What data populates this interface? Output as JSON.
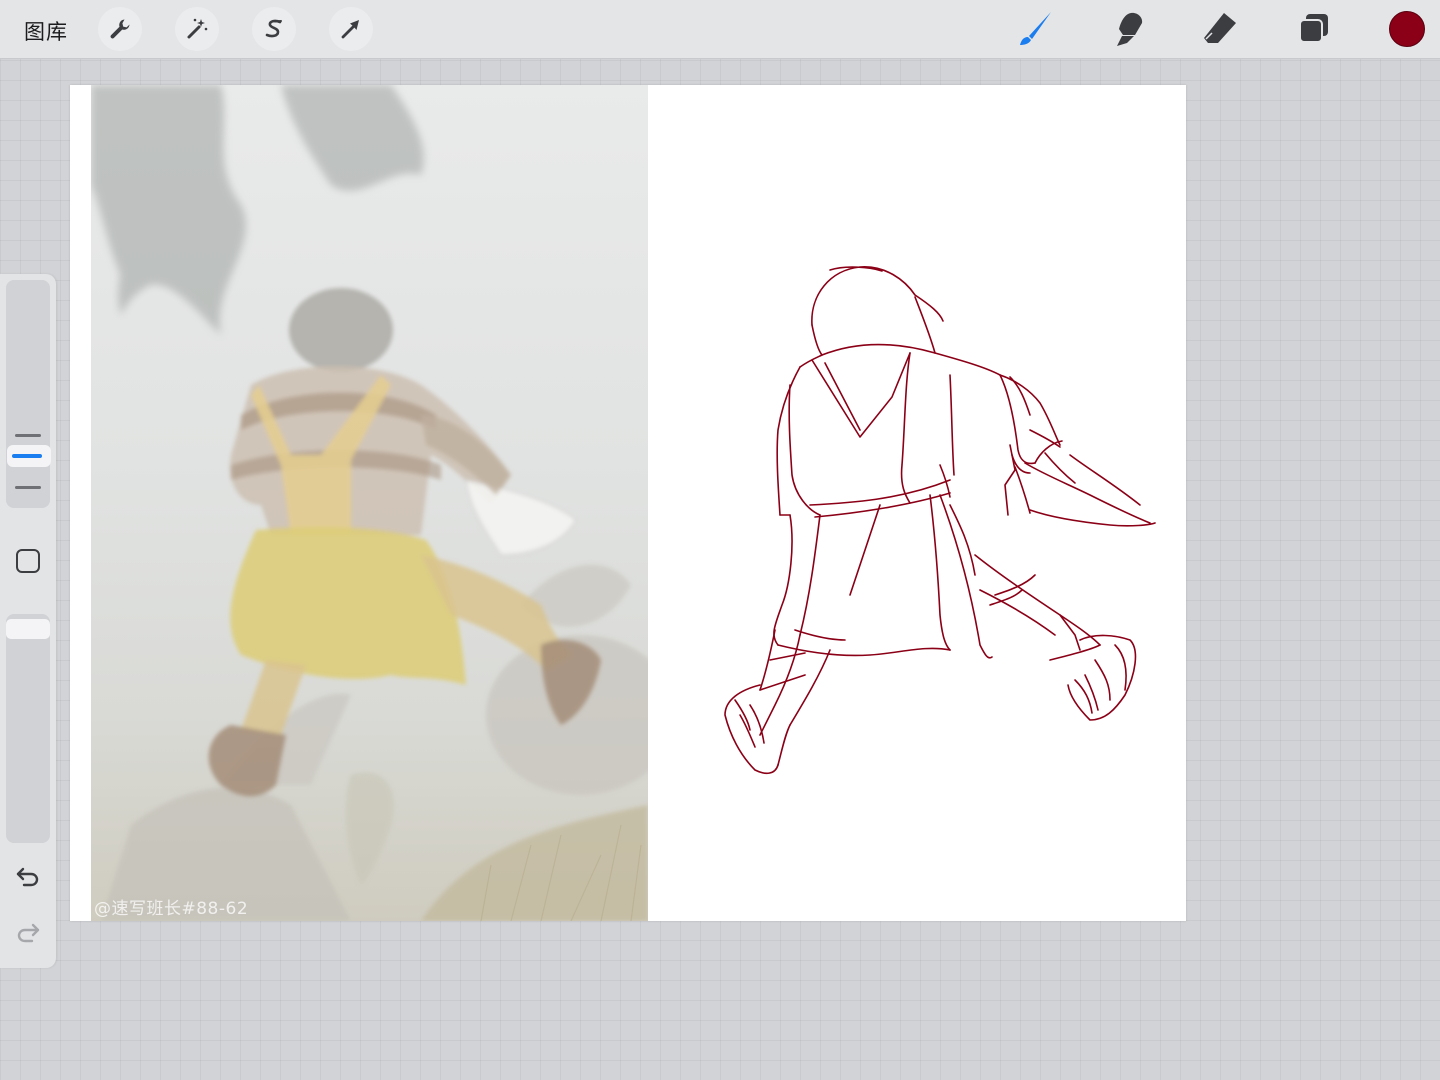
{
  "toolbar": {
    "gallery_label": "图库",
    "left_tools": [
      {
        "name": "actions",
        "icon": "wrench-icon"
      },
      {
        "name": "adjustments",
        "icon": "magic-wand-icon"
      },
      {
        "name": "selection",
        "icon": "selection-s-icon"
      },
      {
        "name": "transform",
        "icon": "arrow-cursor-icon"
      }
    ],
    "right_tools": [
      {
        "name": "brush",
        "icon": "brush-icon",
        "active": true
      },
      {
        "name": "smudge",
        "icon": "smudge-finger-icon"
      },
      {
        "name": "eraser",
        "icon": "eraser-icon"
      },
      {
        "name": "layers",
        "icon": "layers-icon"
      }
    ],
    "current_color": "#8b0016"
  },
  "sidebar": {
    "brush_size_marks": 3,
    "active_size_mark": 2,
    "modify_button_icon": "square-modify-icon",
    "undo_icon": "undo-arrow-icon",
    "redo_icon": "redo-arrow-icon",
    "redo_enabled": false
  },
  "canvas": {
    "background": "#ffffff",
    "reference_photo": {
      "description_icon": "reference-photo",
      "watermark": "@速写班长#88-62"
    },
    "sketch_stroke_color": "#8b0016"
  },
  "colors": {
    "accent_blue": "#1a7df0",
    "toolbar_bg": "#e4e5e7",
    "workspace_bg": "#d1d3d6"
  }
}
